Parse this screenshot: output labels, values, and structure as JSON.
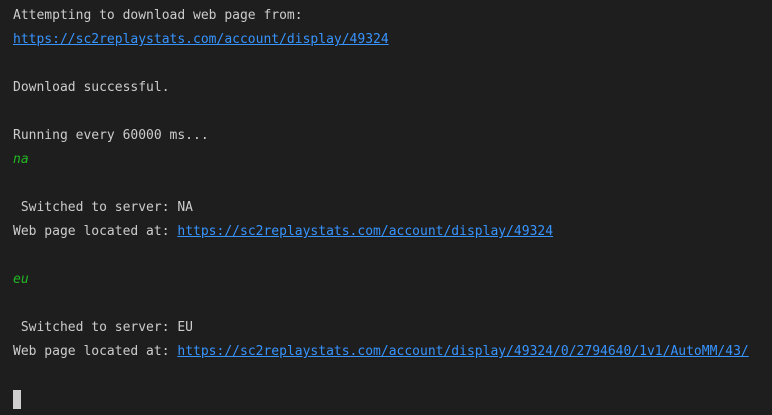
{
  "terminal": {
    "attempting": "Attempting to download web page from:",
    "url_initial": "https://sc2replaystats.com/account/display/49324",
    "download_success": "Download successful.",
    "running": "Running every 60000 ms...",
    "region_na": "na",
    "switched_na": " Switched to server: NA",
    "located_label_1": "Web page located at: ",
    "url_na": "https://sc2replaystats.com/account/display/49324",
    "region_eu": "eu",
    "switched_eu": " Switched to server: EU",
    "located_label_2": "Web page located at: ",
    "url_eu": "https://sc2replaystats.com/account/display/49324/0/2794640/1v1/AutoMM/43/"
  },
  "colors": {
    "background": "#1e1e1e",
    "text": "#cccccc",
    "link": "#3794ff",
    "region": "#23b823"
  }
}
